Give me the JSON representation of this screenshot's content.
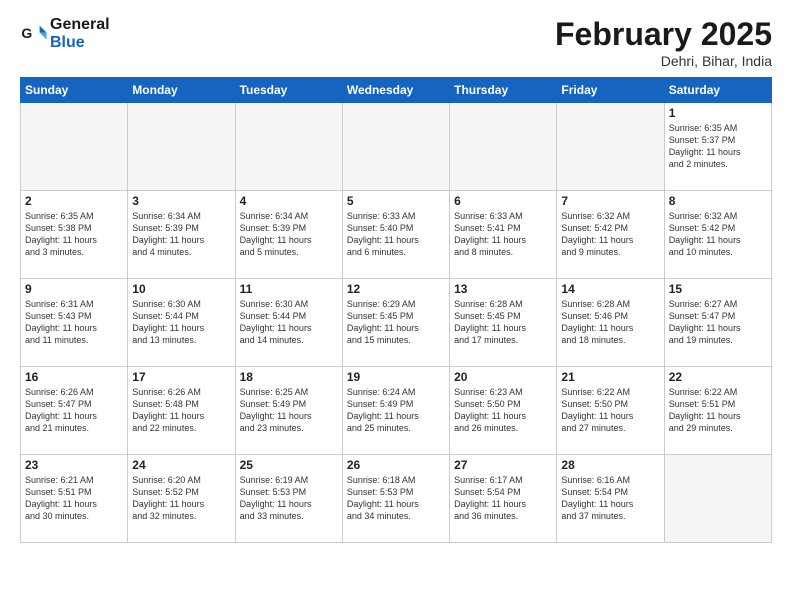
{
  "header": {
    "logo_general": "General",
    "logo_blue": "Blue",
    "month_title": "February 2025",
    "subtitle": "Dehri, Bihar, India"
  },
  "days_of_week": [
    "Sunday",
    "Monday",
    "Tuesday",
    "Wednesday",
    "Thursday",
    "Friday",
    "Saturday"
  ],
  "weeks": [
    {
      "stripe": false,
      "days": [
        {
          "num": "",
          "text": ""
        },
        {
          "num": "",
          "text": ""
        },
        {
          "num": "",
          "text": ""
        },
        {
          "num": "",
          "text": ""
        },
        {
          "num": "",
          "text": ""
        },
        {
          "num": "",
          "text": ""
        },
        {
          "num": "1",
          "text": "Sunrise: 6:35 AM\nSunset: 5:37 PM\nDaylight: 11 hours\nand 2 minutes."
        }
      ]
    },
    {
      "stripe": true,
      "days": [
        {
          "num": "2",
          "text": "Sunrise: 6:35 AM\nSunset: 5:38 PM\nDaylight: 11 hours\nand 3 minutes."
        },
        {
          "num": "3",
          "text": "Sunrise: 6:34 AM\nSunset: 5:39 PM\nDaylight: 11 hours\nand 4 minutes."
        },
        {
          "num": "4",
          "text": "Sunrise: 6:34 AM\nSunset: 5:39 PM\nDaylight: 11 hours\nand 5 minutes."
        },
        {
          "num": "5",
          "text": "Sunrise: 6:33 AM\nSunset: 5:40 PM\nDaylight: 11 hours\nand 6 minutes."
        },
        {
          "num": "6",
          "text": "Sunrise: 6:33 AM\nSunset: 5:41 PM\nDaylight: 11 hours\nand 8 minutes."
        },
        {
          "num": "7",
          "text": "Sunrise: 6:32 AM\nSunset: 5:42 PM\nDaylight: 11 hours\nand 9 minutes."
        },
        {
          "num": "8",
          "text": "Sunrise: 6:32 AM\nSunset: 5:42 PM\nDaylight: 11 hours\nand 10 minutes."
        }
      ]
    },
    {
      "stripe": false,
      "days": [
        {
          "num": "9",
          "text": "Sunrise: 6:31 AM\nSunset: 5:43 PM\nDaylight: 11 hours\nand 11 minutes."
        },
        {
          "num": "10",
          "text": "Sunrise: 6:30 AM\nSunset: 5:44 PM\nDaylight: 11 hours\nand 13 minutes."
        },
        {
          "num": "11",
          "text": "Sunrise: 6:30 AM\nSunset: 5:44 PM\nDaylight: 11 hours\nand 14 minutes."
        },
        {
          "num": "12",
          "text": "Sunrise: 6:29 AM\nSunset: 5:45 PM\nDaylight: 11 hours\nand 15 minutes."
        },
        {
          "num": "13",
          "text": "Sunrise: 6:28 AM\nSunset: 5:45 PM\nDaylight: 11 hours\nand 17 minutes."
        },
        {
          "num": "14",
          "text": "Sunrise: 6:28 AM\nSunset: 5:46 PM\nDaylight: 11 hours\nand 18 minutes."
        },
        {
          "num": "15",
          "text": "Sunrise: 6:27 AM\nSunset: 5:47 PM\nDaylight: 11 hours\nand 19 minutes."
        }
      ]
    },
    {
      "stripe": true,
      "days": [
        {
          "num": "16",
          "text": "Sunrise: 6:26 AM\nSunset: 5:47 PM\nDaylight: 11 hours\nand 21 minutes."
        },
        {
          "num": "17",
          "text": "Sunrise: 6:26 AM\nSunset: 5:48 PM\nDaylight: 11 hours\nand 22 minutes."
        },
        {
          "num": "18",
          "text": "Sunrise: 6:25 AM\nSunset: 5:49 PM\nDaylight: 11 hours\nand 23 minutes."
        },
        {
          "num": "19",
          "text": "Sunrise: 6:24 AM\nSunset: 5:49 PM\nDaylight: 11 hours\nand 25 minutes."
        },
        {
          "num": "20",
          "text": "Sunrise: 6:23 AM\nSunset: 5:50 PM\nDaylight: 11 hours\nand 26 minutes."
        },
        {
          "num": "21",
          "text": "Sunrise: 6:22 AM\nSunset: 5:50 PM\nDaylight: 11 hours\nand 27 minutes."
        },
        {
          "num": "22",
          "text": "Sunrise: 6:22 AM\nSunset: 5:51 PM\nDaylight: 11 hours\nand 29 minutes."
        }
      ]
    },
    {
      "stripe": false,
      "days": [
        {
          "num": "23",
          "text": "Sunrise: 6:21 AM\nSunset: 5:51 PM\nDaylight: 11 hours\nand 30 minutes."
        },
        {
          "num": "24",
          "text": "Sunrise: 6:20 AM\nSunset: 5:52 PM\nDaylight: 11 hours\nand 32 minutes."
        },
        {
          "num": "25",
          "text": "Sunrise: 6:19 AM\nSunset: 5:53 PM\nDaylight: 11 hours\nand 33 minutes."
        },
        {
          "num": "26",
          "text": "Sunrise: 6:18 AM\nSunset: 5:53 PM\nDaylight: 11 hours\nand 34 minutes."
        },
        {
          "num": "27",
          "text": "Sunrise: 6:17 AM\nSunset: 5:54 PM\nDaylight: 11 hours\nand 36 minutes."
        },
        {
          "num": "28",
          "text": "Sunrise: 6:16 AM\nSunset: 5:54 PM\nDaylight: 11 hours\nand 37 minutes."
        },
        {
          "num": "",
          "text": ""
        }
      ]
    }
  ]
}
